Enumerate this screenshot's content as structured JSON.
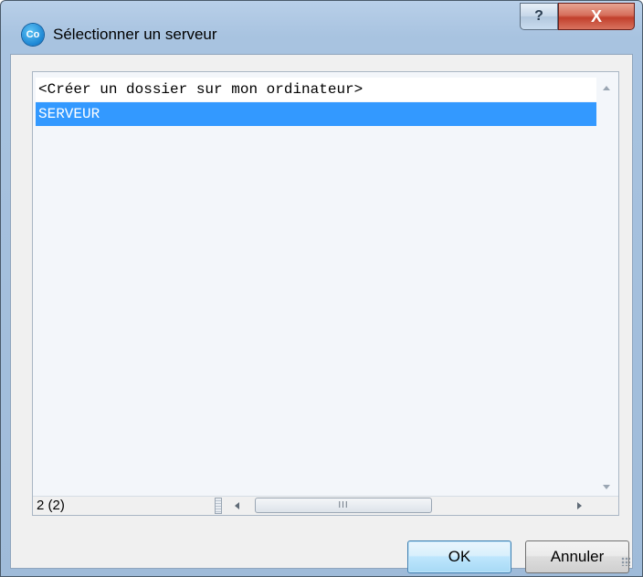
{
  "window": {
    "title": "Sélectionner un serveur",
    "app_icon_text": "Co",
    "help_label": "?",
    "close_label": "X"
  },
  "list": {
    "items": [
      "<Créer un dossier sur mon ordinateur>",
      "SERVEUR"
    ],
    "selected_index": 1,
    "status_count": "2 (2)",
    "hscroll_grip": "III"
  },
  "buttons": {
    "ok_label": "OK",
    "cancel_label": "Annuler"
  },
  "colors": {
    "selection": "#3399ff",
    "close_button": "#c1402c",
    "titlebar": "#a8c3e0"
  }
}
